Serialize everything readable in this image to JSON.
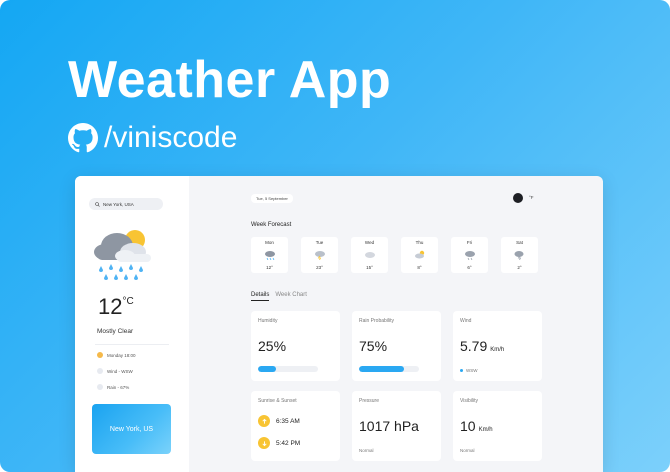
{
  "hero": {
    "title": "Weather App",
    "handle": "/viniscode"
  },
  "sidebar": {
    "search_value": "New York, USA",
    "temperature": "12",
    "temp_unit": "°C",
    "condition": "Mostly Clear",
    "rows": [
      {
        "text": "Monday 18:00",
        "color": "#f5b94a"
      },
      {
        "text": "Wind - WSW",
        "color": "#e7eaf0"
      },
      {
        "text": "Rain - 67%",
        "color": "#e7eaf0"
      }
    ],
    "city_card": "New York, US"
  },
  "header": {
    "date": "Tue, 5 September",
    "unit_toggle": "°F"
  },
  "forecast": {
    "title": "Week Forecast",
    "days": [
      {
        "name": "Mon",
        "temp": "12°",
        "icon": "rain-cloud-icon"
      },
      {
        "name": "Tue",
        "temp": "23°",
        "icon": "storm-cloud-icon"
      },
      {
        "name": "Wed",
        "temp": "15°",
        "icon": "cloud-icon"
      },
      {
        "name": "Thu",
        "temp": "8°",
        "icon": "sun-cloud-icon"
      },
      {
        "name": "Fri",
        "temp": "6°",
        "icon": "rain-cloud-icon"
      },
      {
        "name": "Sat",
        "temp": "2°",
        "icon": "storm-cloud-icon"
      }
    ]
  },
  "tabs": {
    "details": "Details",
    "week_chart": "Week Chart"
  },
  "cards": {
    "humidity": {
      "title": "Humidity",
      "value": "25%",
      "level_percent": 30
    },
    "rain": {
      "title": "Rain Probability",
      "value": "75%",
      "level_percent": 75
    },
    "wind": {
      "title": "Wind",
      "value": "5.79",
      "unit": "Km/h",
      "direction": "WSW"
    },
    "sun": {
      "title": "Sunrise & Sunset",
      "sunrise": "6:35 AM",
      "sunset": "5:42 PM"
    },
    "pressure": {
      "title": "Pressure",
      "value": "1017 hPa",
      "status": "Normal"
    },
    "visibility": {
      "title": "Visibility",
      "value": "10",
      "unit": "Km/h",
      "status": "Normal"
    }
  },
  "colors": {
    "accent": "#2aa8f2",
    "sun": "#f8c433",
    "hero_gradient_start": "#14a7f3",
    "hero_gradient_end": "#7cd0fb"
  }
}
